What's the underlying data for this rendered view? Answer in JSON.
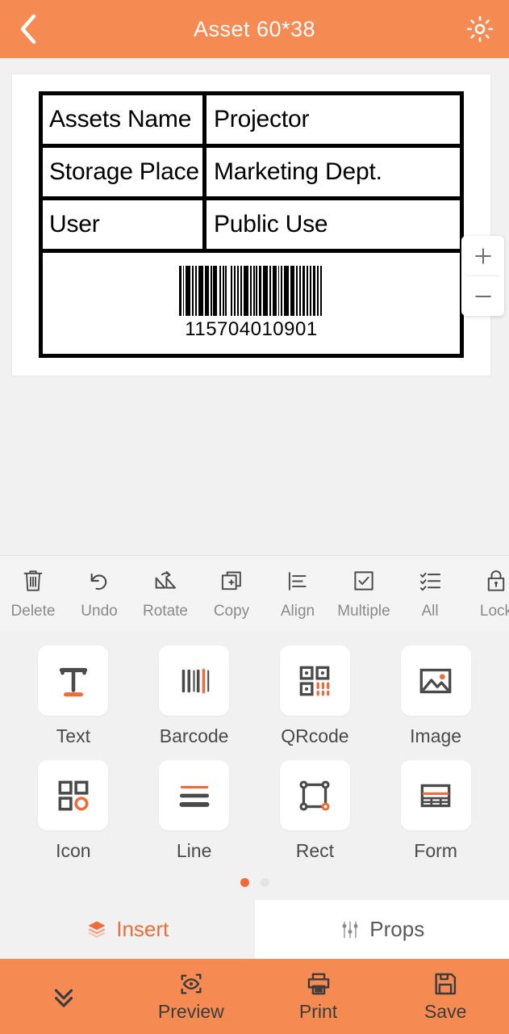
{
  "header": {
    "title": "Asset  60*38",
    "back_icon": "chevron-left-icon",
    "settings_icon": "gear-icon"
  },
  "canvas": {
    "zoom_in_label": "+",
    "zoom_out_label": "−",
    "label_rows": [
      {
        "key": "Assets Name",
        "value": "Projector"
      },
      {
        "key": "Storage Place",
        "value": "Marketing Dept."
      },
      {
        "key": "User",
        "value": "Public Use"
      }
    ],
    "barcode": {
      "number": "115704010901",
      "pattern": [
        3,
        2,
        1,
        2,
        6,
        2,
        2,
        2,
        2,
        2,
        6,
        2,
        5,
        2,
        2,
        1,
        5,
        3,
        2,
        2,
        2,
        1,
        2,
        5,
        2,
        2,
        2,
        2,
        2,
        2,
        2,
        2,
        6,
        2,
        2,
        2,
        2,
        1,
        2,
        2,
        3,
        2,
        6,
        2,
        2,
        2,
        5,
        2,
        1,
        2,
        2,
        2,
        6,
        2,
        5,
        2,
        2,
        2,
        2,
        2,
        3,
        2,
        2,
        2,
        2,
        2,
        3,
        2,
        2,
        2,
        2,
        3
      ]
    }
  },
  "object_toolbar": {
    "items": [
      {
        "label": "Delete",
        "icon": "trash-icon"
      },
      {
        "label": "Undo",
        "icon": "undo-icon"
      },
      {
        "label": "Rotate",
        "icon": "rotate-icon"
      },
      {
        "label": "Copy",
        "icon": "copy-icon"
      },
      {
        "label": "Align",
        "icon": "align-left-icon"
      },
      {
        "label": "Multiple",
        "icon": "checkbox-icon"
      },
      {
        "label": "All",
        "icon": "checklist-icon"
      },
      {
        "label": "Lock",
        "icon": "lock-icon"
      }
    ]
  },
  "insert_panel": {
    "tools": [
      {
        "label": "Text",
        "icon": "text-tool-icon"
      },
      {
        "label": "Barcode",
        "icon": "barcode-tool-icon"
      },
      {
        "label": "QRcode",
        "icon": "qrcode-tool-icon"
      },
      {
        "label": "Image",
        "icon": "image-tool-icon"
      },
      {
        "label": "Icon",
        "icon": "icon-tool-icon"
      },
      {
        "label": "Line",
        "icon": "line-tool-icon"
      },
      {
        "label": "Rect",
        "icon": "rect-tool-icon"
      },
      {
        "label": "Form",
        "icon": "form-tool-icon"
      }
    ],
    "page_count": 2,
    "active_page": 1
  },
  "tabs": [
    {
      "label": "Insert",
      "icon": "layers-icon",
      "active": true
    },
    {
      "label": "Props",
      "icon": "sliders-icon",
      "active": false
    }
  ],
  "bottom_bar": {
    "collapse_icon": "chevron-double-down-icon",
    "items": [
      {
        "label": "Preview",
        "icon": "preview-eye-icon"
      },
      {
        "label": "Print",
        "icon": "printer-icon"
      },
      {
        "label": "Save",
        "icon": "floppy-save-icon"
      }
    ]
  },
  "colors": {
    "header_orange": "#f58a52",
    "accent_orange": "#ef6c3a",
    "icon_dark": "#4a4a4a",
    "toolbar_label": "#8a8a8a",
    "page_bg": "#f1f1f1"
  }
}
